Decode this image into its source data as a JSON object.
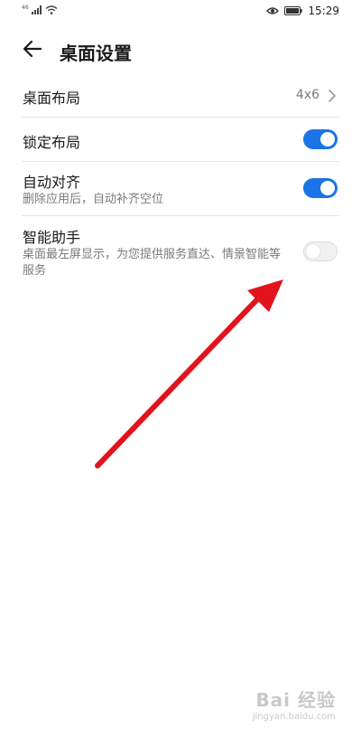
{
  "status_bar": {
    "network_type": "46",
    "time": "15:29",
    "signal_icon": "signal-bars-icon",
    "wifi_icon": "wifi-icon",
    "eye_icon": "eye-comfort-icon",
    "battery_icon": "battery-icon"
  },
  "header": {
    "title": "桌面设置",
    "back_icon": "back-arrow-icon"
  },
  "settings": {
    "layout": {
      "label": "桌面布局",
      "value": "4x6"
    },
    "lock_layout": {
      "label": "锁定布局",
      "enabled": true
    },
    "auto_align": {
      "label": "自动对齐",
      "description": "删除应用后，自动补齐空位",
      "enabled": true
    },
    "smart_assistant": {
      "label": "智能助手",
      "description": "桌面最左屏显示，为您提供服务直达、情景智能等服务",
      "enabled": false
    }
  },
  "colors": {
    "toggle_on": "#1a74e6",
    "annotation_arrow": "#e3131b"
  },
  "watermark": {
    "main": "Bai 经验",
    "sub": "jingyan.baidu.com"
  }
}
